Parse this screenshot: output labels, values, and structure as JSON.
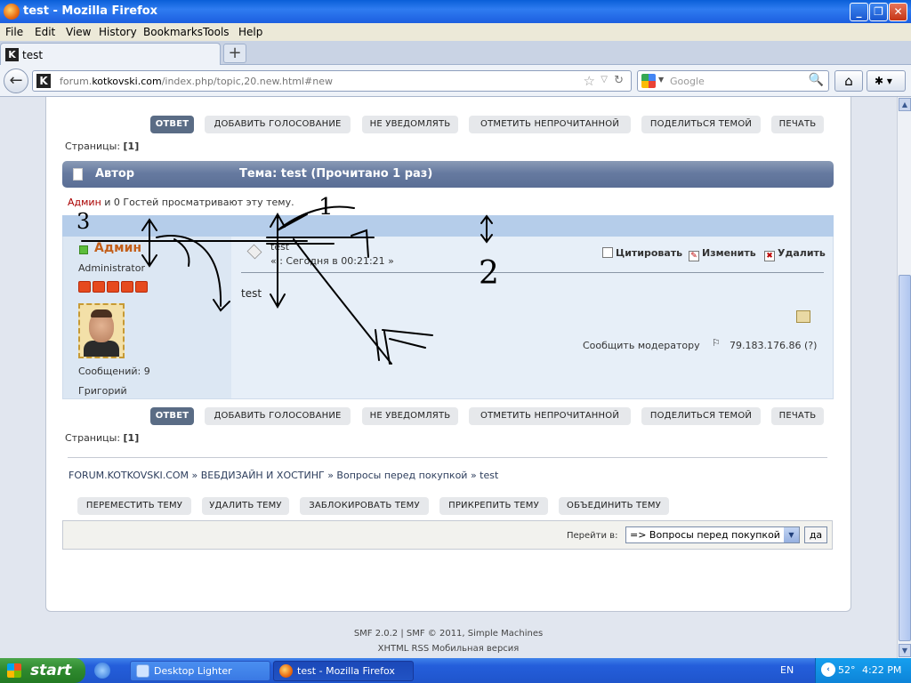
{
  "window": {
    "title": "test - Mozilla Firefox"
  },
  "menu": [
    "File",
    "Edit",
    "View",
    "History",
    "Bookmarks",
    "Tools",
    "Help"
  ],
  "tab": {
    "label": "test",
    "favicon": "K",
    "new_tab": "+"
  },
  "nav": {
    "url_host": "forum.kotkovski.com",
    "url_path": "/index.php/topic,20.new.html#new",
    "url_prefix": "forum.",
    "url_domain": "kotkovski.com",
    "search_placeholder": "Google",
    "favicon": "K"
  },
  "topic_buttons": [
    "ОТВЕТ",
    "ДОБАВИТЬ ГОЛОСОВАНИЕ",
    "НЕ УВЕДОМЛЯТЬ",
    "ОТМЕТИТЬ НЕПРОЧИТАННОЙ",
    "ПОДЕЛИТЬСЯ ТЕМОЙ",
    "ПЕЧАТЬ"
  ],
  "pages_label": "Страницы:",
  "pages_value": "[1]",
  "header": {
    "author": "Автор",
    "topic": "Тема: test  (Прочитано 1 раз)"
  },
  "viewers": {
    "admin": "Админ",
    "rest": " и 0 Гостей просматривают эту тему."
  },
  "post": {
    "poster_name": "Админ",
    "poster_role": "Administrator",
    "stars": 5,
    "posts_label": "Сообщений: 9",
    "real_name": "Григорий",
    "subject": "test",
    "date": "« : Сегодня в 00:21:21 »",
    "quote": "Цитировать",
    "modify": "Изменить",
    "delete": "Удалить",
    "body": "test",
    "report": "Сообщить модератору",
    "ip": "79.183.176.86 (?)"
  },
  "breadcrumb": "FORUM.KOTKOVSKI.COM » ВЕБДИЗАЙН И ХОСТИНГ » Вопросы перед покупкой » test",
  "mod_buttons": [
    "ПЕРЕМЕСТИТЬ ТЕМУ",
    "УДАЛИТЬ ТЕМУ",
    "ЗАБЛОКИРОВАТЬ ТЕМУ",
    "ПРИКРЕПИТЬ ТЕМУ",
    "ОБЪЕДИНИТЬ ТЕМУ"
  ],
  "jump": {
    "label": "Перейти в:",
    "selected": "=> Вопросы перед покупкой",
    "go": "да"
  },
  "footer": {
    "line1": "SMF 2.0.2 | SMF © 2011, Simple Machines",
    "line2": "XHTML   RSS   Мобильная версия"
  },
  "annotations": [
    "1",
    "2",
    "3"
  ],
  "taskbar": {
    "start": "start",
    "items": [
      "Desktop Lighter",
      "test - Mozilla Firefox"
    ],
    "lang": "EN",
    "temp": "52°",
    "clock": "4:22 PM"
  },
  "colors": {
    "active_button": "#5a6c85",
    "header_bar": "#667aa0",
    "admin": "#c35f1a",
    "post_bg": "#e7eff8"
  }
}
